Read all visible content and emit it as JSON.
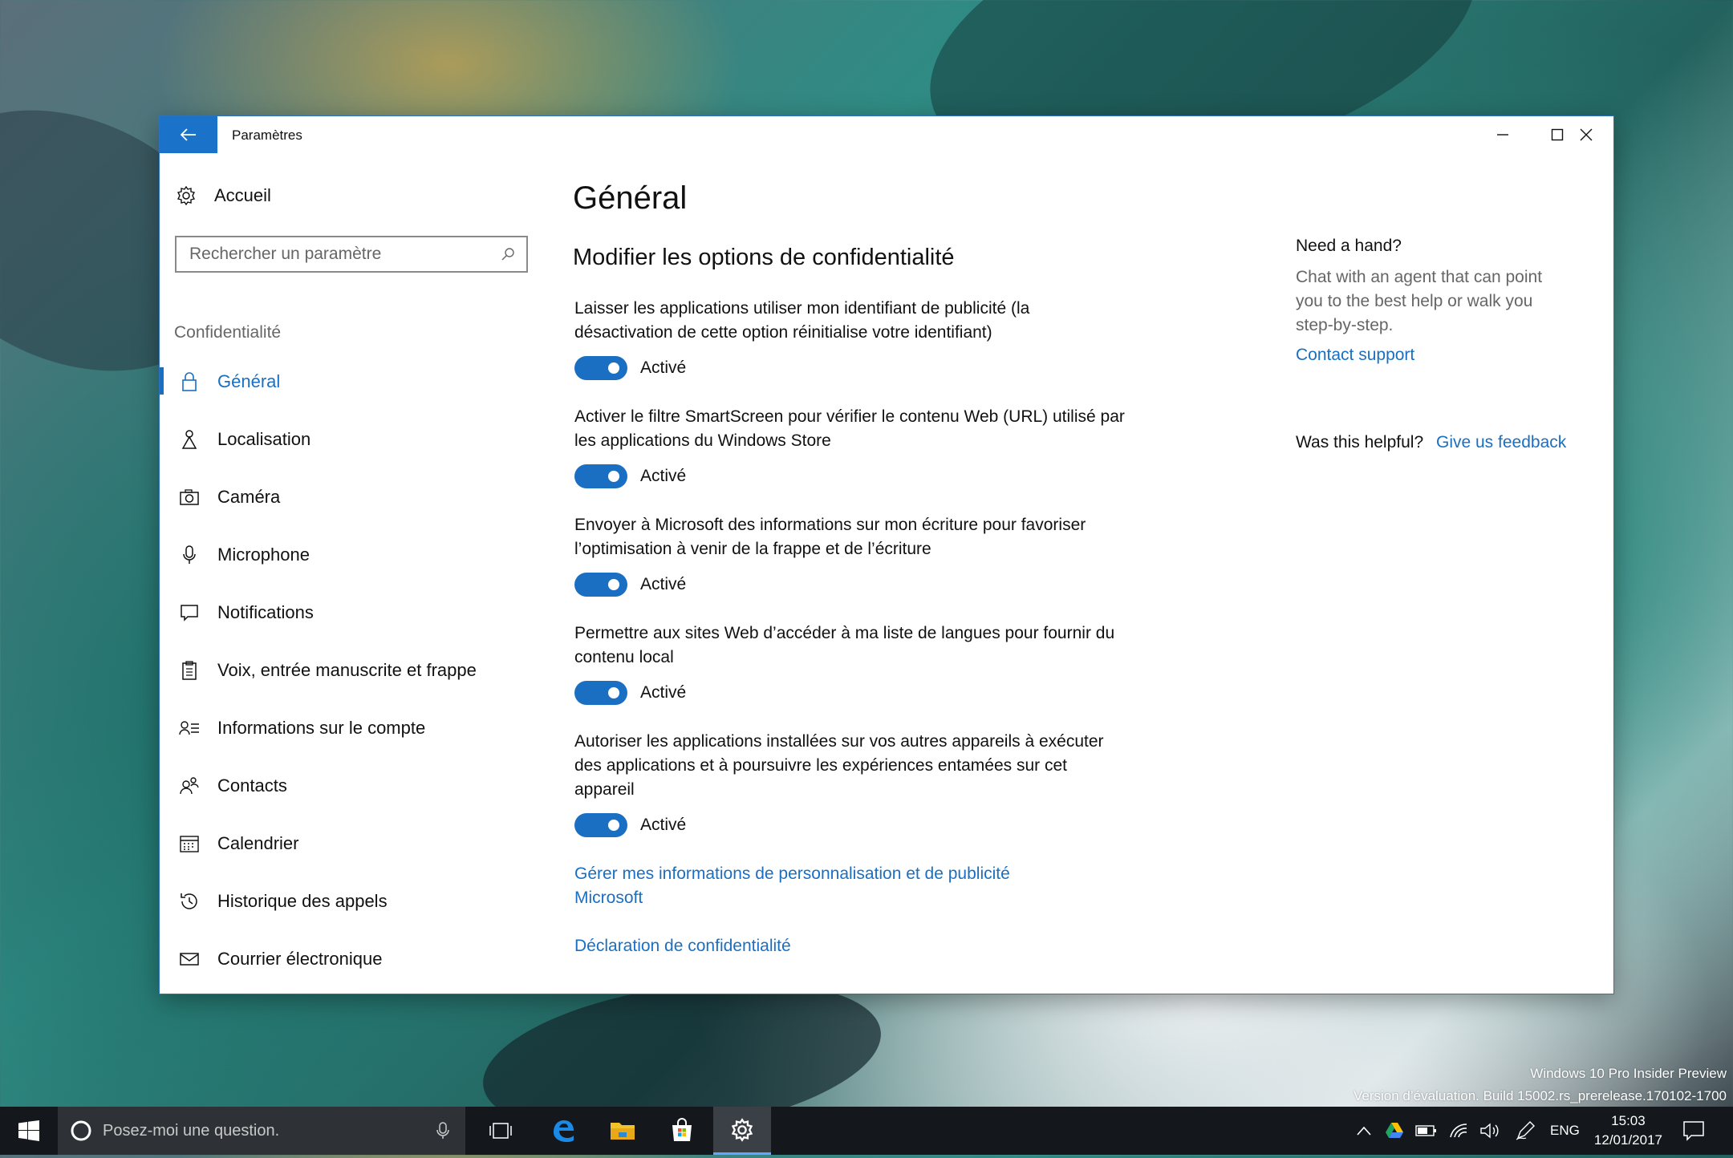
{
  "window": {
    "title": "Paramètres",
    "back_icon": "back-arrow-icon",
    "accent": "#1a73c8"
  },
  "sidebar": {
    "home_label": "Accueil",
    "search_placeholder": "Rechercher un paramètre",
    "section_title": "Confidentialité",
    "items": [
      {
        "label": "Général",
        "icon": "lock-icon",
        "active": true
      },
      {
        "label": "Localisation",
        "icon": "location-icon"
      },
      {
        "label": "Caméra",
        "icon": "camera-icon"
      },
      {
        "label": "Microphone",
        "icon": "microphone-icon"
      },
      {
        "label": "Notifications",
        "icon": "notifications-icon"
      },
      {
        "label": "Voix, entrée manuscrite et frappe",
        "icon": "clipboard-icon"
      },
      {
        "label": "Informations sur le compte",
        "icon": "account-info-icon"
      },
      {
        "label": "Contacts",
        "icon": "contacts-icon"
      },
      {
        "label": "Calendrier",
        "icon": "calendar-icon"
      },
      {
        "label": "Historique des appels",
        "icon": "history-icon"
      },
      {
        "label": "Courrier électronique",
        "icon": "mail-icon"
      }
    ]
  },
  "main": {
    "title": "Général",
    "subtitle": "Modifier les options de confidentialité",
    "options": [
      {
        "label": "Laisser les applications utiliser mon identifiant de publicité (la désactivation de cette option réinitialise votre identifiant)",
        "state": "Activé",
        "on": true
      },
      {
        "label": "Activer le filtre SmartScreen pour vérifier le contenu Web (URL) utilisé par les applications du Windows Store",
        "state": "Activé",
        "on": true
      },
      {
        "label": "Envoyer à Microsoft des informations sur mon écriture pour favoriser l’optimisation à venir de la frappe et de l’écriture",
        "state": "Activé",
        "on": true
      },
      {
        "label": "Permettre aux sites Web d’accéder à ma liste de langues pour fournir du contenu local",
        "state": "Activé",
        "on": true
      },
      {
        "label": "Autoriser les applications installées sur vos autres appareils à exécuter des applications et à poursuivre les expériences entamées sur cet appareil",
        "state": "Activé",
        "on": true
      }
    ],
    "link_manage": "Gérer mes informations de personnalisation et de publicité Microsoft",
    "link_privacy": "Déclaration de confidentialité"
  },
  "help": {
    "title": "Need a hand?",
    "text": "Chat with an agent that can point you to the best help or walk you step-by-step.",
    "contact": "Contact support",
    "helpful_label": "Was this helpful?",
    "feedback": "Give us feedback"
  },
  "desktop": {
    "watermark_line1": "Windows 10 Pro Insider Preview",
    "watermark_line2": "Version d’évaluation. Build 15002.rs_prerelease.170102-1700"
  },
  "taskbar": {
    "search_placeholder": "Posez-moi une question.",
    "language": "ENG",
    "time": "15:03",
    "date": "12/01/2017"
  }
}
